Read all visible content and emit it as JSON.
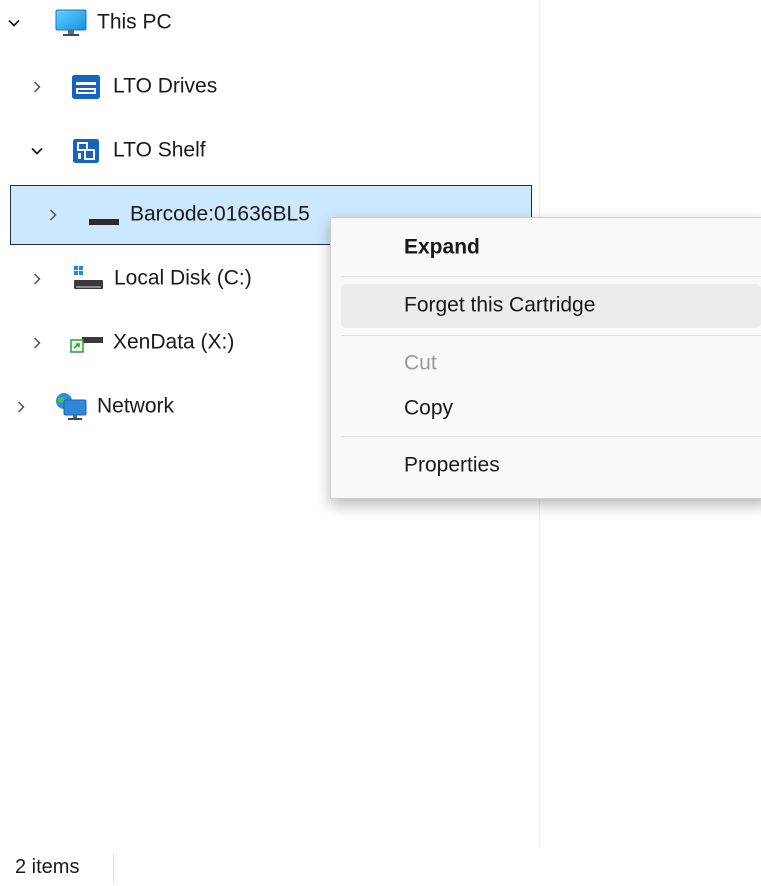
{
  "tree": {
    "this_pc": {
      "label": "This PC",
      "icon": "monitor-icon",
      "expanded": true
    },
    "lto_drives": {
      "label": "LTO Drives",
      "icon": "tape-drive-icon",
      "expanded": false
    },
    "lto_shelf": {
      "label": "LTO Shelf",
      "icon": "shelf-icon",
      "expanded": true
    },
    "barcode": {
      "label": "Barcode:01636BL5",
      "icon": "cartridge-icon",
      "expanded": false,
      "selected": true
    },
    "local_disk": {
      "label": "Local Disk (C:)",
      "icon": "drive-icon",
      "expanded": false
    },
    "xendata": {
      "label": "XenData (X:)",
      "icon": "network-drive-icon",
      "expanded": false
    },
    "network": {
      "label": "Network",
      "icon": "network-icon",
      "expanded": false
    }
  },
  "context_menu": {
    "expand": "Expand",
    "forget": "Forget this Cartridge",
    "cut": "Cut",
    "copy": "Copy",
    "properties": "Properties"
  },
  "status_bar": {
    "item_count": "2 items"
  },
  "colors": {
    "selection": "#cce8ff",
    "accent": "#0a64c8",
    "menu_bg": "#f9f9f9"
  }
}
